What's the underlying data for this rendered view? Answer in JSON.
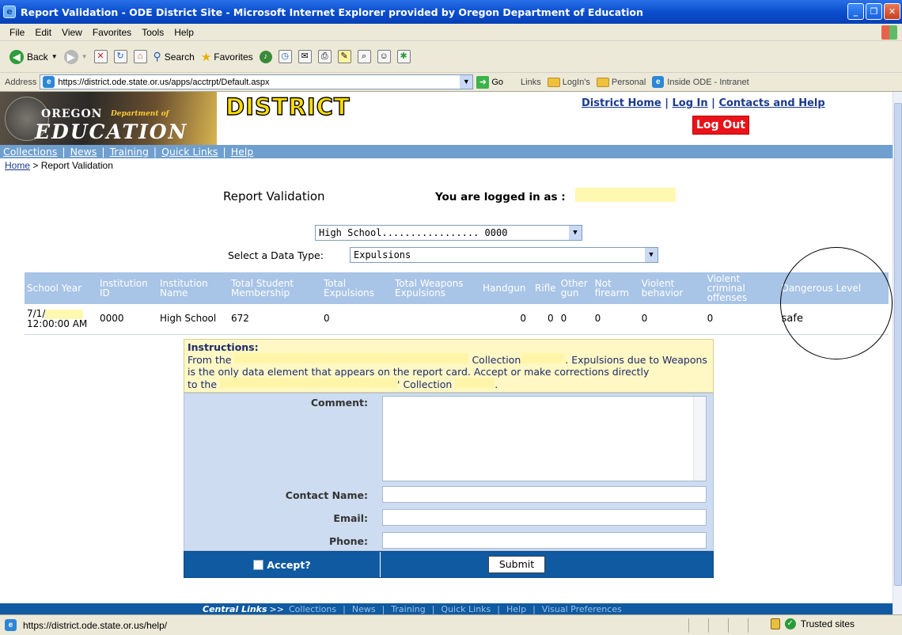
{
  "window": {
    "title": "Report Validation - ODE District Site - Microsoft Internet Explorer provided by Oregon Department of Education"
  },
  "menu": [
    "File",
    "Edit",
    "View",
    "Favorites",
    "Tools",
    "Help"
  ],
  "toolbar": {
    "back": "Back",
    "search": "Search",
    "favorites": "Favorites"
  },
  "address": {
    "label": "Address",
    "url": "https://district.ode.state.or.us/apps/acctrpt/Default.aspx",
    "go": "Go",
    "links_label": "Links",
    "links": [
      "LogIn's",
      "Personal",
      "Inside ODE - Intranet"
    ]
  },
  "header": {
    "logo_oregon": "OREGON",
    "logo_dept": "Department of",
    "logo_education": "EDUCATION",
    "district": "DISTRICT",
    "top_links": [
      "District Home",
      "Log In",
      "Contacts and Help"
    ],
    "logout": "Log Out"
  },
  "nav": [
    "Collections",
    "News",
    "Training",
    "Quick Links",
    "Help"
  ],
  "breadcrumb": {
    "home": "Home",
    "separator": " > ",
    "current": "Report Validation"
  },
  "main": {
    "title": "Report Validation",
    "logged_in_label": "You are logged in as :",
    "school_select": "High School................. 0000",
    "data_type_label": "Select a Data Type:",
    "data_type_value": "Expulsions"
  },
  "table": {
    "headers": [
      "School Year",
      "Institution ID",
      "Institution Name",
      "Total Student Membership",
      "Total Expulsions",
      "Total Weapons Expulsions",
      "Handgun",
      "Rifle",
      "Other gun",
      "Not firearm",
      "Violent behavior",
      "Violent criminal offenses",
      "Dangerous Level"
    ],
    "row": {
      "school_year_a": "7/1/",
      "school_year_b": "12:00:00 AM",
      "institution_id": "0000",
      "institution_name": "High School",
      "total_membership": "672",
      "total_expulsions": "0",
      "total_weapons": "",
      "handgun": "0",
      "rifle": "0",
      "other_gun": "0",
      "not_firearm": "0",
      "violent_behavior": "0",
      "violent_criminal": "0",
      "dangerous_level": "safe"
    }
  },
  "form": {
    "instructions_heading": "Instructions:",
    "instr_1a": "From the",
    "instr_1b": "Collection",
    "instr_1c": ". Expulsions due to Weapons",
    "instr_2": "is the only data element that appears on the report card. Accept or make corrections directly",
    "instr_3a": "to the",
    "instr_3b": "' Collection",
    "instr_3c": ".",
    "comment_label": "Comment:",
    "contact_label": "Contact Name:",
    "email_label": "Email:",
    "phone_label": "Phone:",
    "accept_label": "Accept?",
    "submit_label": "Submit"
  },
  "central_links": {
    "label": "Central Links",
    "arrow": ">>",
    "items": [
      "Collections",
      "News",
      "Training",
      "Quick Links",
      "Help",
      "Visual Preferences"
    ]
  },
  "status": {
    "url": "https://district.ode.state.or.us/help/",
    "zone": "Trusted sites"
  }
}
